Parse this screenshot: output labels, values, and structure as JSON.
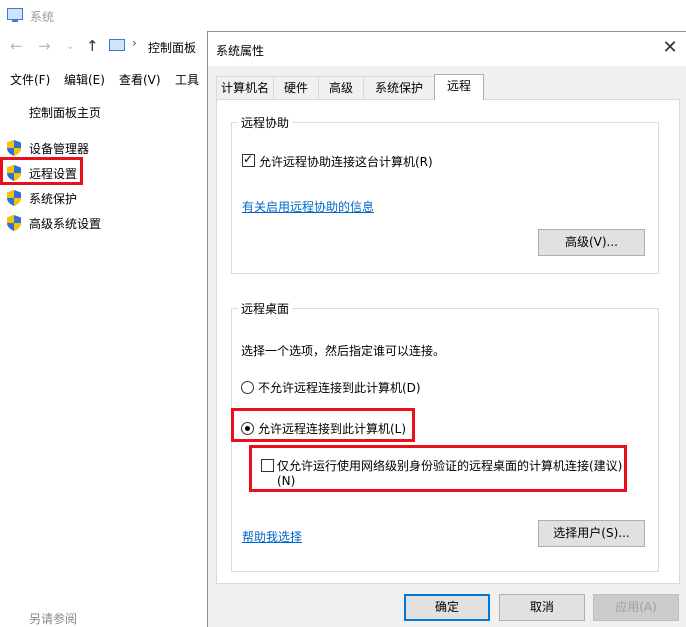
{
  "background_window": {
    "title": "系统",
    "address": "控制面板",
    "menu": [
      "文件(F)",
      "编辑(E)",
      "查看(V)",
      "工具"
    ],
    "left_panel": {
      "home": "控制面板主页",
      "items": [
        "设备管理器",
        "远程设置",
        "系统保护",
        "高级系统设置"
      ],
      "see_also": "另请参阅"
    }
  },
  "dialog": {
    "title": "系统属性",
    "tabs": [
      "计算机名",
      "硬件",
      "高级",
      "系统保护",
      "远程"
    ],
    "active_tab": "远程",
    "remote_assistance": {
      "group_title": "远程协助",
      "allow_label": "允许远程协助连接这台计算机(R)",
      "allow_checked": true,
      "info_link": "有关启用远程协助的信息",
      "advanced_button": "高级(V)..."
    },
    "remote_desktop": {
      "group_title": "远程桌面",
      "instruction": "选择一个选项，然后指定谁可以连接。",
      "option_disallow": "不允许远程连接到此计算机(D)",
      "option_allow": "允许远程连接到此计算机(L)",
      "selected_option": "allow",
      "nla_label_line1": "仅允许运行使用网络级别身份验证的远程桌面的计算机连接(建议)",
      "nla_label_line2": "(N)",
      "nla_checked": false,
      "help_link": "帮助我选择",
      "select_users_button": "选择用户(S)..."
    },
    "buttons": {
      "ok": "确定",
      "cancel": "取消",
      "apply": "应用(A)"
    }
  },
  "colors": {
    "highlight_box": "#e8111b",
    "link": "#0066cc",
    "default_button_border": "#0078d7",
    "shield_blue": "#2f6fd6",
    "shield_yellow": "#f5c400"
  }
}
